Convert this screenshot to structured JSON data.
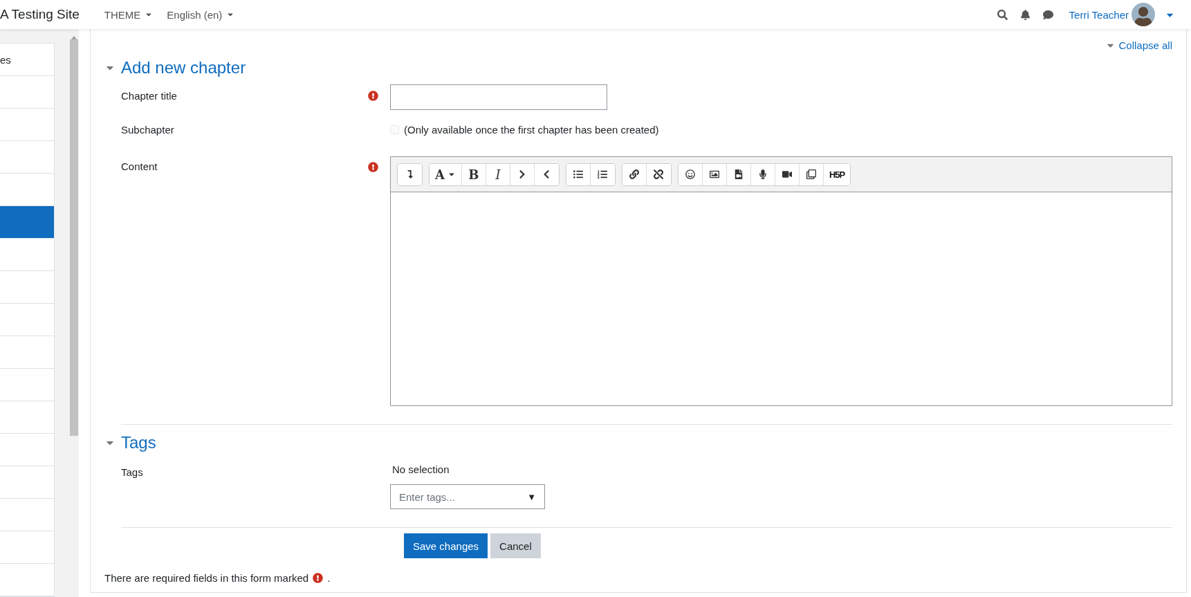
{
  "header": {
    "site_name": "A Testing Site",
    "menus": [
      {
        "label": "THEME"
      },
      {
        "label": "English (en)"
      }
    ],
    "user": {
      "name": "Terri Teacher"
    }
  },
  "sidebar": {
    "items": [
      {
        "label": "es",
        "selected": false
      },
      {
        "selected": false
      },
      {
        "selected": false
      },
      {
        "selected": false
      },
      {
        "selected": false
      },
      {
        "selected": true
      },
      {
        "selected": false
      },
      {
        "selected": false
      },
      {
        "selected": false
      },
      {
        "selected": false
      },
      {
        "selected": false
      },
      {
        "selected": false
      },
      {
        "selected": false
      },
      {
        "selected": false
      },
      {
        "selected": false
      },
      {
        "selected": false
      },
      {
        "selected": false
      }
    ]
  },
  "collapse_all": "Collapse all",
  "sections": [
    {
      "title": "Add new chapter",
      "expanded": true,
      "fields": [
        {
          "kind": "text",
          "label": "Chapter title",
          "required": true
        },
        {
          "kind": "checkbox",
          "label": "Subchapter",
          "checked": false,
          "disabled": true,
          "note": "(Only available once the first chapter has been created)"
        },
        {
          "kind": "editor",
          "label": "Content",
          "required": true,
          "toolbar": {
            "font": "A",
            "bold": "B",
            "italic": "I",
            "h5p": "H5P"
          }
        }
      ]
    },
    {
      "title": "Tags",
      "expanded": true,
      "fields": [
        {
          "kind": "tags",
          "label": "Tags",
          "selection": "No selection",
          "placeholder": "Enter tags...",
          "dropdown_symbol": "▼"
        }
      ]
    }
  ],
  "buttons": [
    {
      "label": "Save changes",
      "kind": "primary"
    },
    {
      "label": "Cancel",
      "kind": "secondary"
    }
  ],
  "footer_note": {
    "before": "There are required fields in this form marked",
    "after": "."
  }
}
